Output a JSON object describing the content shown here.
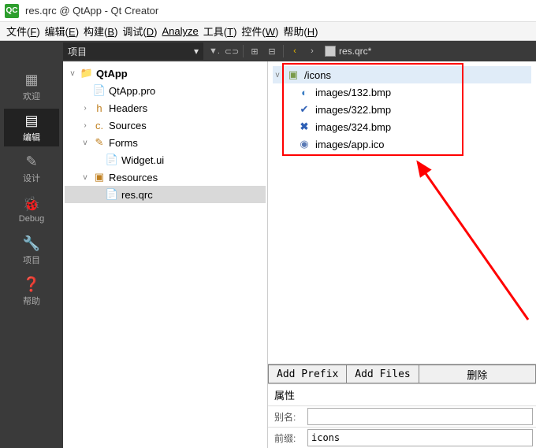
{
  "window": {
    "title": "res.qrc @ QtApp - Qt Creator",
    "logo_text": "QC"
  },
  "menubar": [
    {
      "label": "文件",
      "accel": "F"
    },
    {
      "label": "编辑",
      "accel": "E"
    },
    {
      "label": "构建",
      "accel": "B"
    },
    {
      "label": "调试",
      "accel": "D"
    },
    {
      "label": "Analyze",
      "accel": ""
    },
    {
      "label": "工具",
      "accel": "T"
    },
    {
      "label": "控件",
      "accel": "W"
    },
    {
      "label": "帮助",
      "accel": "H"
    }
  ],
  "toolbar": {
    "combo_label": "项目",
    "path_file": "res.qrc*"
  },
  "sidebar": [
    {
      "icon": "grid",
      "label": "欢迎"
    },
    {
      "icon": "edit",
      "label": "编辑",
      "active": true
    },
    {
      "icon": "pencil",
      "label": "设计"
    },
    {
      "icon": "bug",
      "label": "Debug"
    },
    {
      "icon": "wrench",
      "label": "项目"
    },
    {
      "icon": "help",
      "label": "帮助"
    }
  ],
  "project_tree": {
    "root": "QtApp",
    "pro": "QtApp.pro",
    "headers": "Headers",
    "sources": "Sources",
    "forms": "Forms",
    "widget_ui": "Widget.ui",
    "resources": "Resources",
    "res_qrc": "res.qrc"
  },
  "resource_tree": {
    "prefix": "/icons",
    "files": [
      "images/132.bmp",
      "images/322.bmp",
      "images/324.bmp",
      "images/app.ico"
    ]
  },
  "buttons": {
    "add_prefix": "Add Prefix",
    "add_files": "Add Files",
    "delete": "删除"
  },
  "properties": {
    "section_title": "属性",
    "alias_label": "别名:",
    "alias_value": "",
    "prefix_label": "前缀:",
    "prefix_value": "icons"
  }
}
